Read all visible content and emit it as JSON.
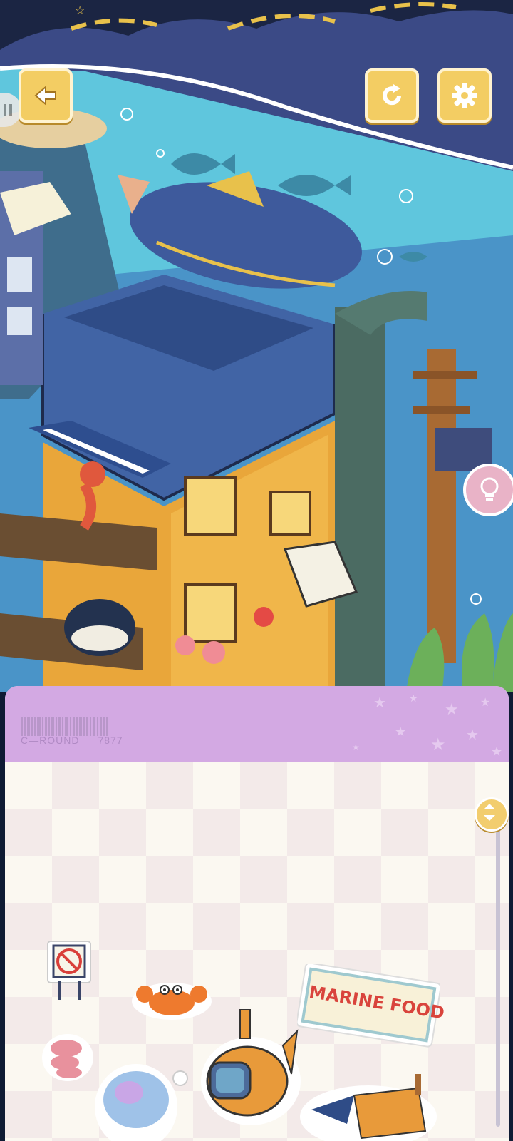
{
  "game": {
    "buttons": {
      "back": "back",
      "restart": "restart",
      "settings": "settings",
      "hint": "hint",
      "pause": "pause"
    },
    "panel": {
      "round_prefix": "C—ROUND",
      "round_number": "7877"
    },
    "sticker_sign_text": "MARINE FOOD",
    "colors": {
      "button_gold": "#f3cd63",
      "panel_header": "#d3a9e3",
      "water": "#5fc6dd",
      "night_sky": "#1b2543"
    },
    "icons": [
      "arrow-left-icon",
      "restart-icon",
      "gear-icon",
      "lightbulb-icon",
      "pause-icon"
    ],
    "inventory_items": [
      "no-swimming-sign",
      "crab",
      "sea-anemone",
      "submarine",
      "marine-food-sign",
      "jellyfish",
      "boat"
    ]
  }
}
